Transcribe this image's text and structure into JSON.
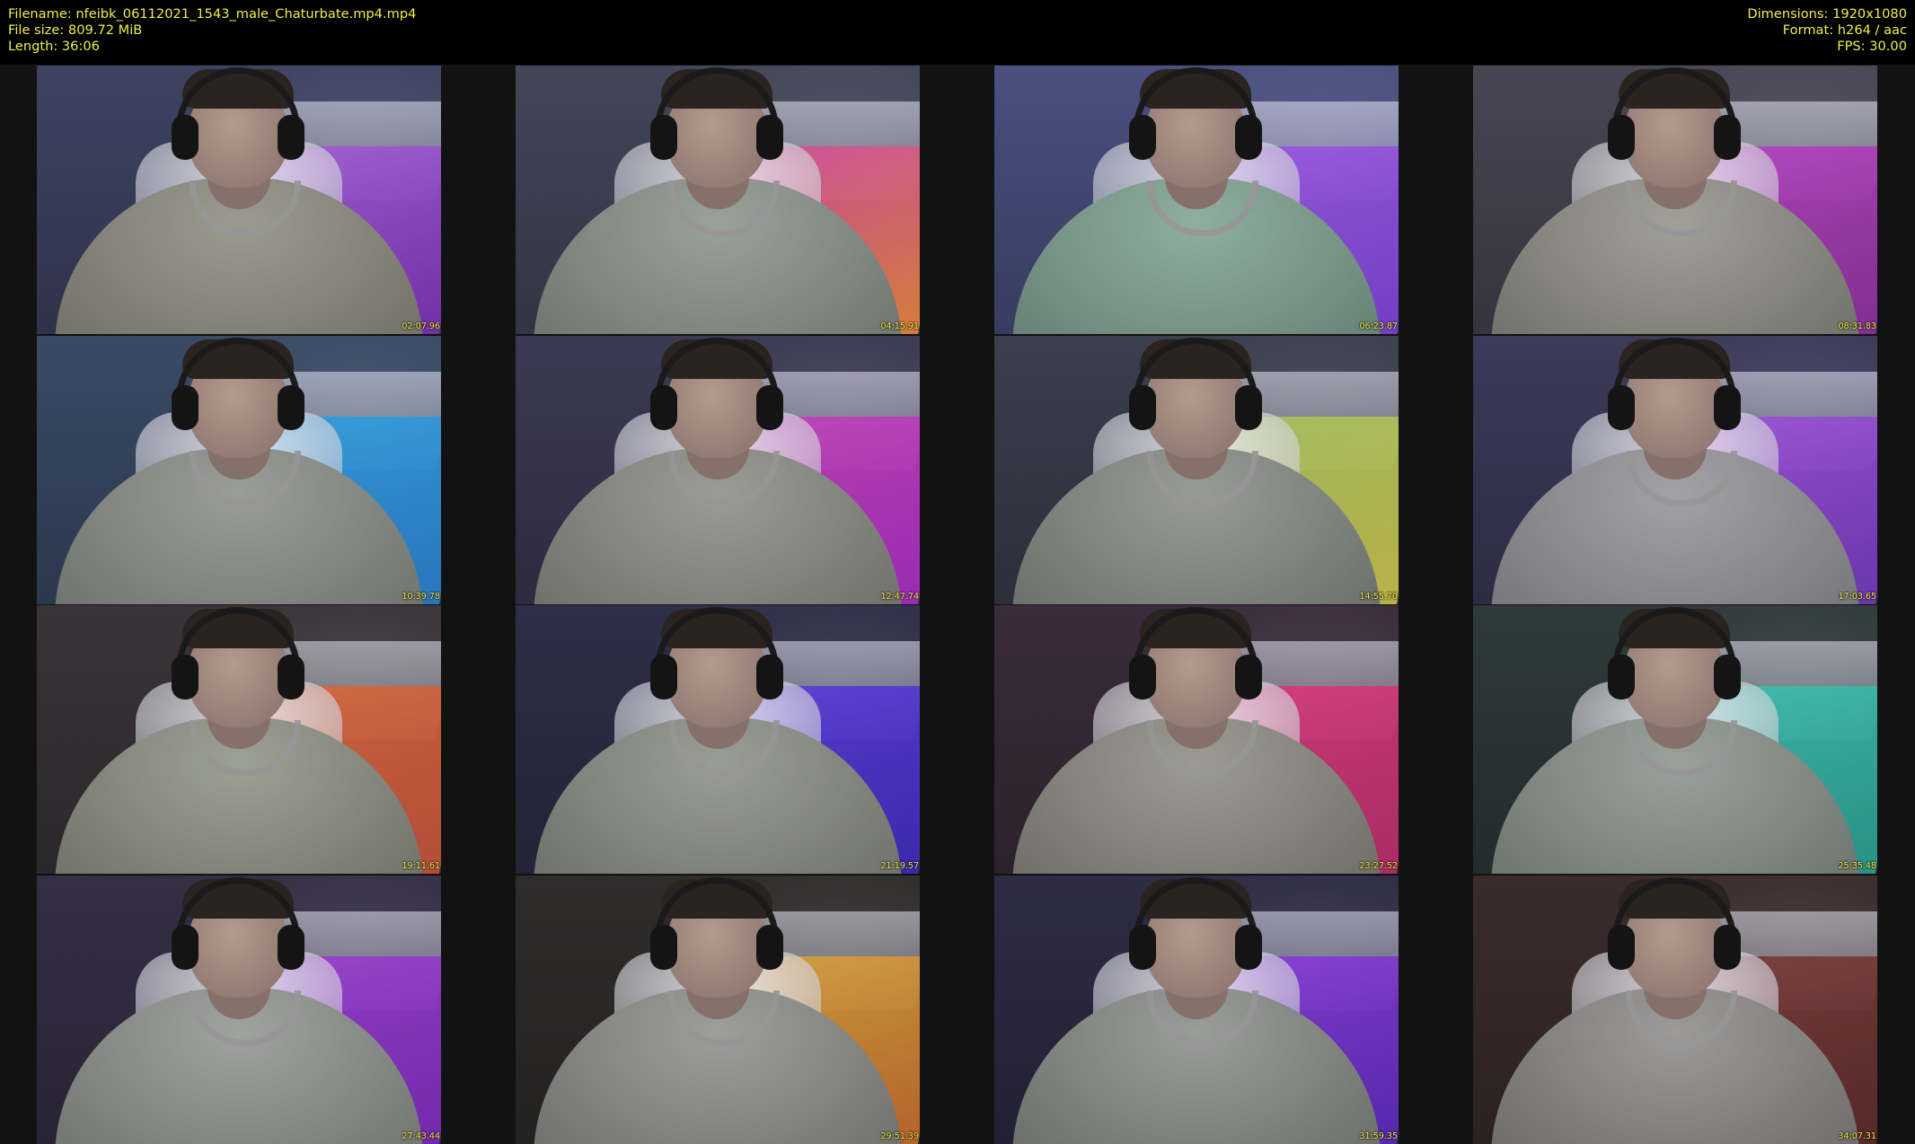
{
  "header": {
    "filename": "Filename: nfeibk_06112021_1543_male_Chaturbate.mp4.mp4",
    "filesize": "File size: 809.72 MiB",
    "length": "Length: 36:06",
    "dimensions": "Dimensions: 1920x1080",
    "format": "Format: h264 / aac",
    "fps": "FPS: 30.00"
  },
  "text_color": "#f2ee4a",
  "thumbnails": [
    {
      "timestamp": "02:07.96",
      "tint": "#3e4363",
      "bed": [
        "#a25bd6",
        "#7b2fb0"
      ],
      "shirt": [
        "#9a9a90",
        "#6f6f66"
      ]
    },
    {
      "timestamp": "04:15.91",
      "tint": "#434659",
      "bed": [
        "#d44a9a",
        "#e7863a"
      ],
      "shirt": [
        "#9aa09a",
        "#6d726c"
      ]
    },
    {
      "timestamp": "06:23.87",
      "tint": "#4a5080",
      "bed": [
        "#9a55e0",
        "#7a3fd0"
      ],
      "shirt": [
        "#8fae9f",
        "#637e73"
      ]
    },
    {
      "timestamp": "08:31.83",
      "tint": "#474653",
      "bed": [
        "#b640c2",
        "#8a2e9a"
      ],
      "shirt": [
        "#a0a098",
        "#6e6e68"
      ]
    },
    {
      "timestamp": "10:39.78",
      "tint": "#3a4a66",
      "bed": [
        "#2f9fe0",
        "#2a7cc8"
      ],
      "shirt": [
        "#9a9c98",
        "#6e706c"
      ]
    },
    {
      "timestamp": "12:47.74",
      "tint": "#3c3954",
      "bed": [
        "#c43fb8",
        "#a52cc0"
      ],
      "shirt": [
        "#9b9b95",
        "#6d6d67"
      ]
    },
    {
      "timestamp": "14:55.70",
      "tint": "#3b3f4e",
      "bed": [
        "#a8c25a",
        "#c9c04a"
      ],
      "shirt": [
        "#989a96",
        "#6a6c68"
      ]
    },
    {
      "timestamp": "17:03.65",
      "tint": "#3d3a5a",
      "bed": [
        "#9e4fd8",
        "#7038b8"
      ],
      "shirt": [
        "#a2a2a6",
        "#747478"
      ]
    },
    {
      "timestamp": "19:11.61",
      "tint": "#3a3438",
      "bed": [
        "#d8663a",
        "#c2523a"
      ],
      "shirt": [
        "#9da095",
        "#6e7067"
      ]
    },
    {
      "timestamp": "21:19.57",
      "tint": "#2e2f48",
      "bed": [
        "#5a3ad8",
        "#3e2ab8"
      ],
      "shirt": [
        "#9a9d95",
        "#6c6f67"
      ]
    },
    {
      "timestamp": "23:27.52",
      "tint": "#3a2c3b",
      "bed": [
        "#d8387a",
        "#b82e6a"
      ],
      "shirt": [
        "#9b9b93",
        "#6c6c65"
      ]
    },
    {
      "timestamp": "25:35.48",
      "tint": "#2f3a3b",
      "bed": [
        "#3abfae",
        "#2a9c90"
      ],
      "shirt": [
        "#9aa19c",
        "#6b726d"
      ]
    },
    {
      "timestamp": "27:43.44",
      "tint": "#352f45",
      "bed": [
        "#9a3ed0",
        "#7a2ab8"
      ],
      "shirt": [
        "#a0a2a0",
        "#707270"
      ]
    },
    {
      "timestamp": "29:51.39",
      "tint": "#2f2d2c",
      "bed": [
        "#d8a23a",
        "#c46a2e"
      ],
      "shirt": [
        "#9d9e99",
        "#6d6e69"
      ]
    },
    {
      "timestamp": "31:59.35",
      "tint": "#2e2b45",
      "bed": [
        "#8a3ad8",
        "#5a2ab8"
      ],
      "shirt": [
        "#9a9c9a",
        "#6a6c6a"
      ]
    },
    {
      "timestamp": "34:07.31",
      "tint": "#3a2c2c",
      "bed": [
        "#7a3a3a",
        "#5a2a2a"
      ],
      "shirt": [
        "#9c9a98",
        "#6c6a68"
      ]
    }
  ]
}
